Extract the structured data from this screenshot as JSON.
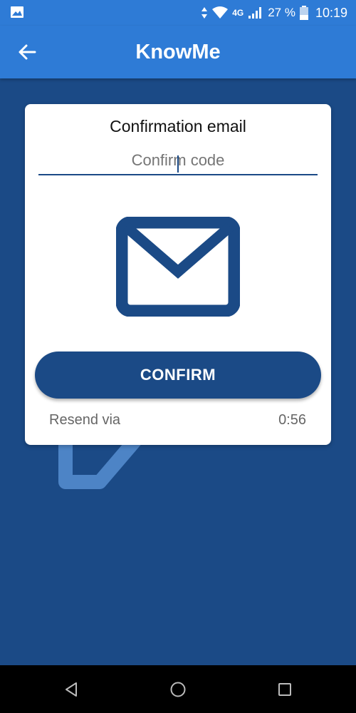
{
  "status_bar": {
    "network": "4G",
    "battery": "27 %",
    "time": "10:19",
    "icons": [
      "image-icon",
      "data-arrows-icon",
      "wifi-icon",
      "signal-icon",
      "battery-icon"
    ]
  },
  "app_bar": {
    "title": "KnowMe",
    "back_icon": "arrow-left-icon"
  },
  "card": {
    "title": "Confirmation email",
    "code_input": {
      "value": "",
      "placeholder": "Confirm code"
    },
    "illustration_icon": "mail-icon",
    "confirm_label": "CONFIRM",
    "resend_label": "Resend via",
    "timer": "0:56"
  },
  "nav_bar": {
    "icons": [
      "back-triangle-icon",
      "home-circle-icon",
      "recents-square-icon"
    ]
  },
  "colors": {
    "primary": "#2e7bd6",
    "dark": "#1b4a86",
    "card": "#ffffff",
    "muted_text": "#666666"
  }
}
